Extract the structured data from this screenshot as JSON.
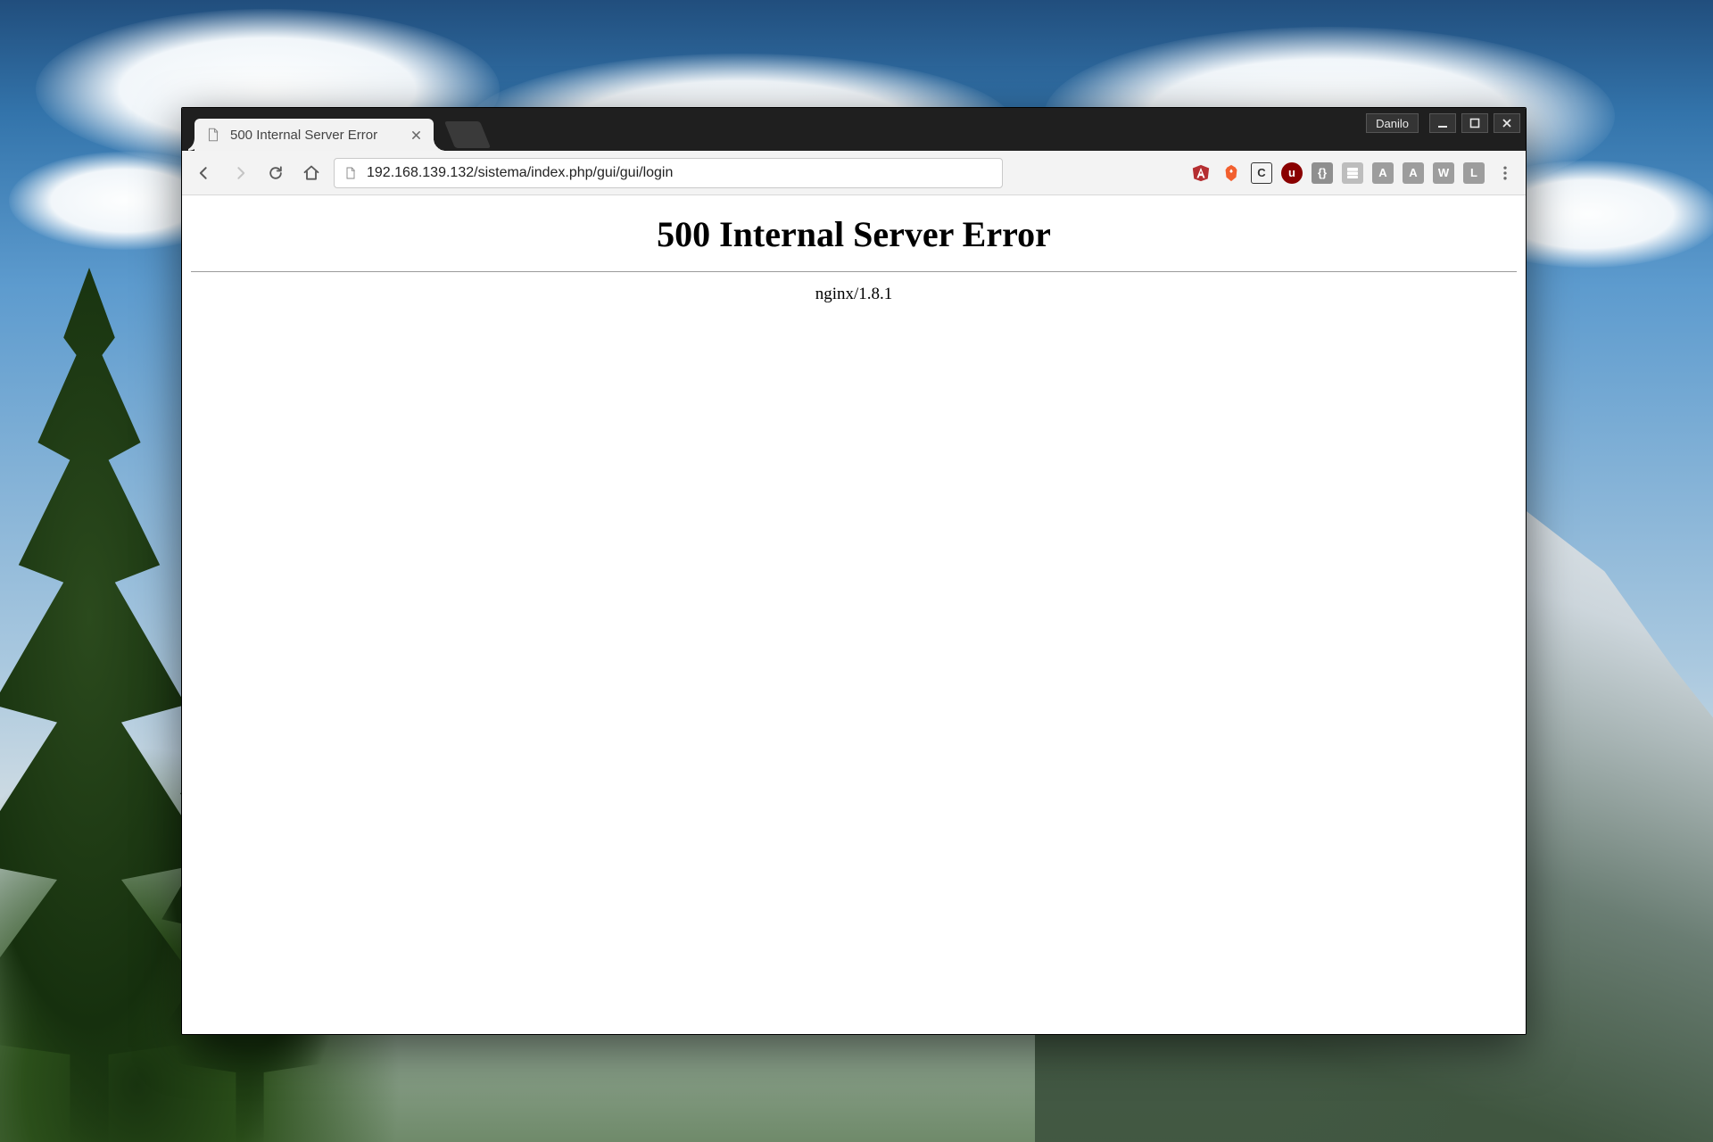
{
  "window": {
    "user_chip": "Danilo"
  },
  "tab": {
    "title": "500 Internal Server Error"
  },
  "toolbar": {
    "url": "192.168.139.132/sistema/index.php/gui/gui/login",
    "extensions": [
      {
        "name": "angular-icon",
        "label": "A",
        "bg": "#b52e31",
        "fg": "#ffffff"
      },
      {
        "name": "brave-icon",
        "label": "",
        "bg": "transparent",
        "fg": "#f25f2e"
      },
      {
        "name": "copy-icon",
        "label": "C",
        "bg": "transparent",
        "fg": "#333333"
      },
      {
        "name": "ublock-icon",
        "label": "u",
        "bg": "#8a0000",
        "fg": "#ffffff"
      },
      {
        "name": "devtools-icon",
        "label": "{}",
        "bg": "#8f8f8f",
        "fg": "#ffffff"
      },
      {
        "name": "storage-icon",
        "label": "",
        "bg": "#bdbdbd",
        "fg": "#6c6c6c"
      },
      {
        "name": "angular2-icon",
        "label": "A",
        "bg": "#9d9d9d",
        "fg": "#ffffff"
      },
      {
        "name": "a-ext-icon",
        "label": "A",
        "bg": "#9d9d9d",
        "fg": "#ffffff"
      },
      {
        "name": "w-ext-icon",
        "label": "W",
        "bg": "#9d9d9d",
        "fg": "#ffffff"
      },
      {
        "name": "l-ext-icon",
        "label": "L",
        "bg": "#9d9d9d",
        "fg": "#ffffff"
      }
    ]
  },
  "page": {
    "heading": "500 Internal Server Error",
    "server_line": "nginx/1.8.1"
  }
}
